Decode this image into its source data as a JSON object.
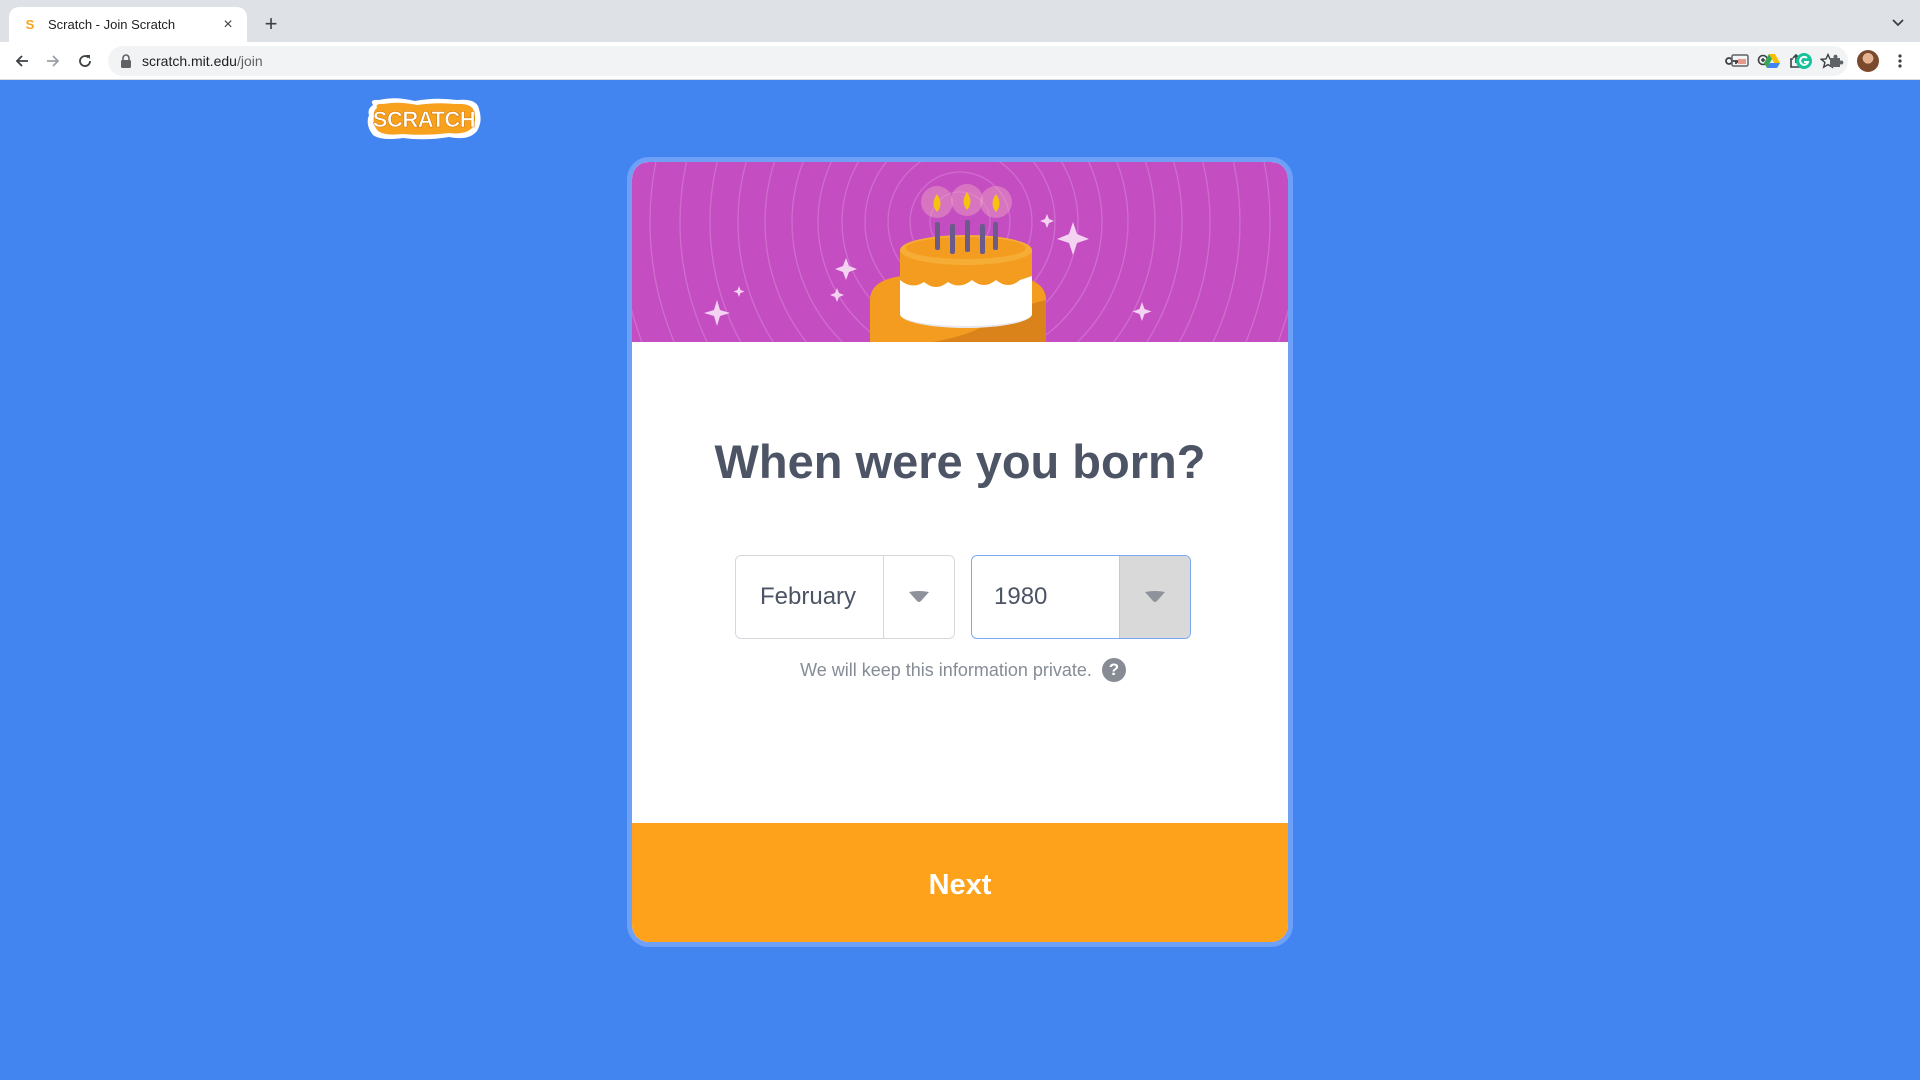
{
  "browser": {
    "tab": {
      "title": "Scratch - Join Scratch",
      "favicon": "scratch-favicon",
      "close": "×"
    },
    "new_tab": "+",
    "url": {
      "host": "scratch.mit.edu",
      "path": "/join"
    }
  },
  "page": {
    "logo_text": "SCRATCH",
    "question": "When were you born?",
    "month": {
      "value": "February"
    },
    "year": {
      "value": "1980"
    },
    "privacy_text": "We will keep this information private.",
    "help_icon": "?",
    "next_label": "Next"
  },
  "colors": {
    "page_bg": "#4285f0",
    "banner_bg": "#c44dc2",
    "next_button": "#fea21c",
    "heading_text": "#4c5465"
  }
}
